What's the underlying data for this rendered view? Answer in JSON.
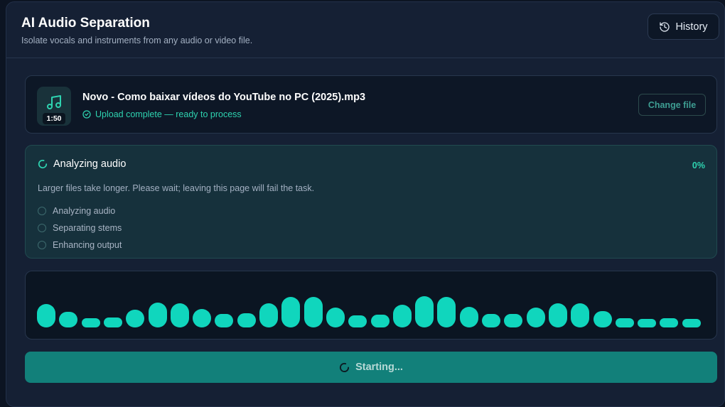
{
  "header": {
    "title": "AI Audio Separation",
    "subtitle": "Isolate vocals and instruments from any audio or video file.",
    "history_label": "History"
  },
  "file": {
    "name": "Novo - Como baixar vídeos do YouTube no PC (2025).mp3",
    "duration": "1:50",
    "status": "Upload complete — ready to process",
    "change_label": "Change file"
  },
  "analysis": {
    "title": "Analyzing audio",
    "percent": "0%",
    "note": "Larger files take longer. Please wait; leaving this page will fail the task.",
    "steps": [
      "Analyzing audio",
      "Separating stems",
      "Enhancing output"
    ]
  },
  "waveform": {
    "levels": [
      0.55,
      0.36,
      0.22,
      0.24,
      0.42,
      0.58,
      0.56,
      0.44,
      0.32,
      0.34,
      0.56,
      0.72,
      0.72,
      0.46,
      0.28,
      0.3,
      0.54,
      0.73,
      0.72,
      0.48,
      0.32,
      0.32,
      0.46,
      0.57,
      0.56,
      0.38,
      0.22,
      0.2,
      0.21,
      0.2
    ]
  },
  "action": {
    "label": "Starting..."
  },
  "colors": {
    "accent": "#10d6bd",
    "background": "#0c1422",
    "button": "#12807a"
  }
}
